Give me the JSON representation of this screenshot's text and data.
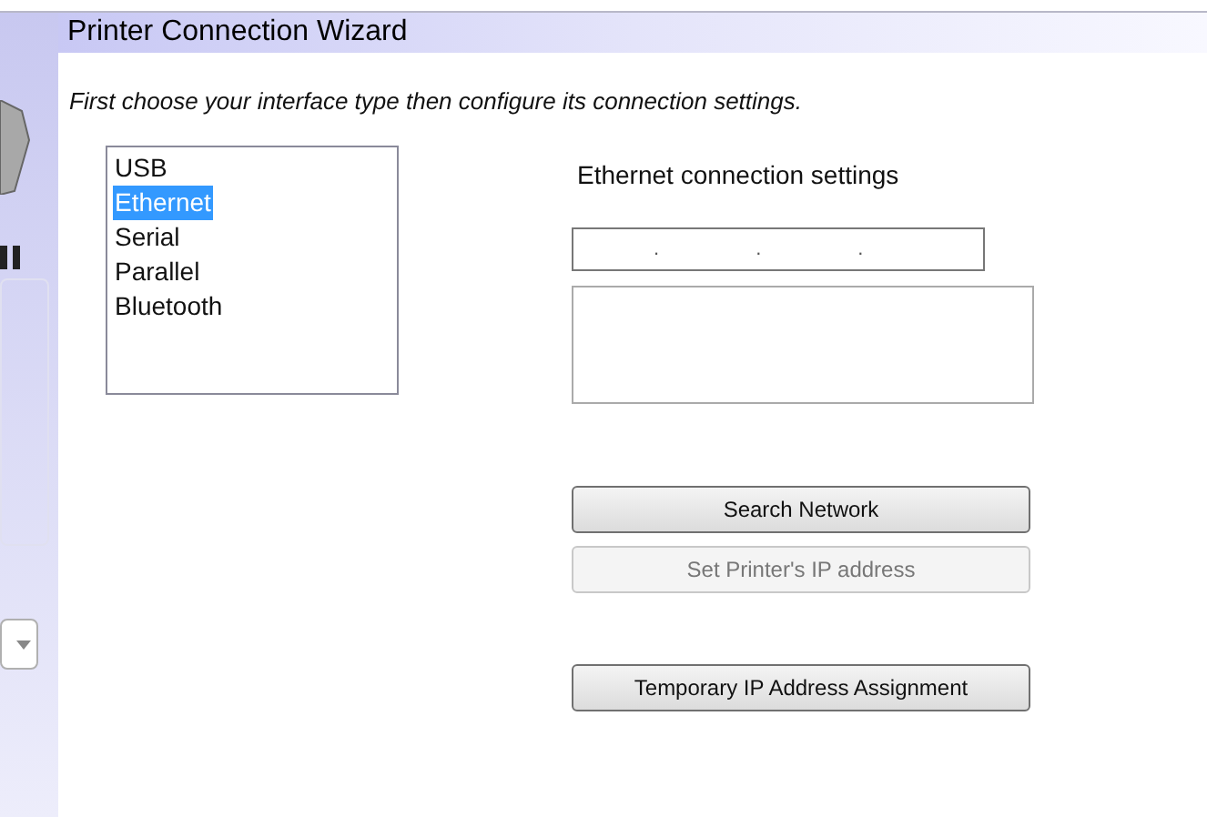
{
  "window": {
    "title": "Printer Connection Wizard"
  },
  "instruction": "First choose your interface type then configure its connection settings.",
  "interfaces": [
    {
      "label": "USB",
      "selected": false
    },
    {
      "label": "Ethernet",
      "selected": true
    },
    {
      "label": "Serial",
      "selected": false
    },
    {
      "label": "Parallel",
      "selected": false
    },
    {
      "label": "Bluetooth",
      "selected": false
    }
  ],
  "settings": {
    "heading": "Ethernet connection settings",
    "ip_separators": [
      ".",
      ".",
      "."
    ]
  },
  "buttons": [
    {
      "label": "Search Network",
      "disabled": false
    },
    {
      "label": "Set Printer's IP address",
      "disabled": true
    },
    {
      "label": "Temporary IP Address Assignment",
      "disabled": false
    }
  ]
}
